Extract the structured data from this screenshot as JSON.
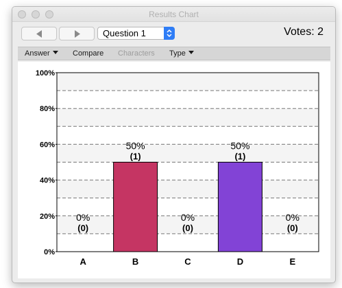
{
  "window": {
    "title": "Results Chart"
  },
  "nav": {
    "prev_icon": "triangle-left-icon",
    "next_icon": "triangle-right-icon"
  },
  "question_select": {
    "value": "Question 1",
    "stepper_icon": "up-down-chevron-icon"
  },
  "votes": {
    "label": "Votes: 2"
  },
  "toolbar": {
    "answer": "Answer",
    "compare": "Compare",
    "characters": "Characters",
    "type": "Type"
  },
  "colors": {
    "bar_b": "#c53563",
    "bar_d": "#8243d6",
    "select_accent": "#2f7df6"
  },
  "chart_data": {
    "type": "bar",
    "categories": [
      "A",
      "B",
      "C",
      "D",
      "E"
    ],
    "values": [
      0,
      50,
      0,
      50,
      0
    ],
    "counts": [
      0,
      1,
      0,
      1,
      0
    ],
    "value_labels": [
      "0%",
      "50%",
      "0%",
      "50%",
      "0%"
    ],
    "count_labels": [
      "(0)",
      "(1)",
      "(0)",
      "(1)",
      "(0)"
    ],
    "bar_colors": [
      null,
      "#c53563",
      null,
      "#8243d6",
      null
    ],
    "ylim": [
      0,
      100
    ],
    "yticks": [
      0,
      20,
      40,
      60,
      80,
      100
    ],
    "ytick_labels": [
      "0%",
      "20%",
      "40%",
      "60%",
      "80%",
      "100%"
    ],
    "grid": "dashed every 10%, alternating light bands",
    "xlabel": "",
    "ylabel": ""
  }
}
